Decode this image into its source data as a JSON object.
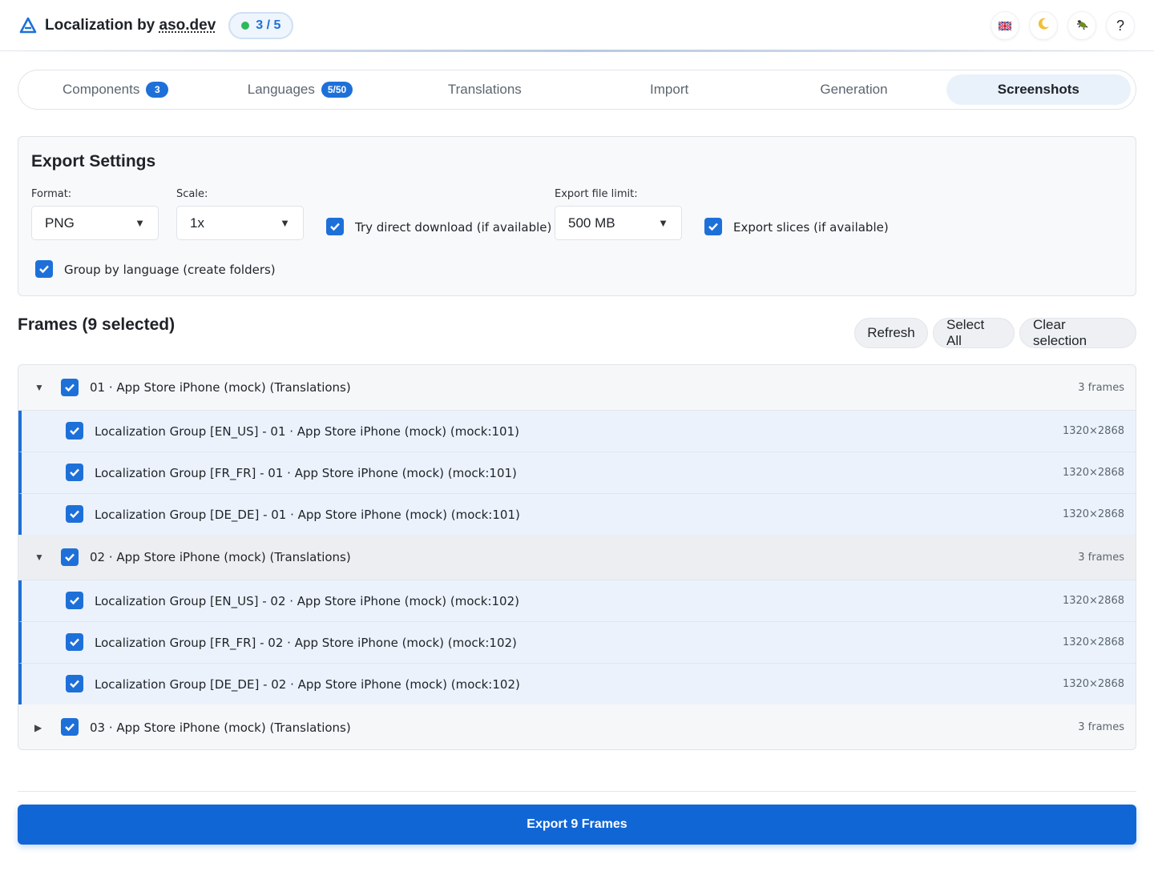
{
  "header": {
    "title_prefix": "Localization by ",
    "title_link": "aso.dev",
    "progress": "3 / 5",
    "progress_color": "#2eb85c",
    "icons": [
      "uk-flag-icon",
      "moon-icon",
      "bug-icon",
      "help-icon"
    ],
    "help_label": "?"
  },
  "tabs": [
    {
      "label": "Components",
      "badge": "3"
    },
    {
      "label": "Languages",
      "badge": "5/50"
    },
    {
      "label": "Translations"
    },
    {
      "label": "Import"
    },
    {
      "label": "Generation"
    },
    {
      "label": "Screenshots",
      "active": true
    }
  ],
  "settings": {
    "title": "Export Settings",
    "format_label": "Format:",
    "format_value": "PNG",
    "scale_label": "Scale:",
    "scale_value": "1x",
    "direct_download_label": "Try direct download (if available)",
    "direct_download_checked": true,
    "file_limit_label": "Export file limit:",
    "file_limit_value": "500 MB",
    "export_slices_label": "Export slices (if available)",
    "export_slices_checked": true,
    "group_by_language_label": "Group by language (create folders)",
    "group_by_language_checked": true
  },
  "frames": {
    "title": "Frames (9 selected)",
    "refresh_label": "Refresh",
    "select_all_label": "Select All",
    "clear_label": "Clear selection",
    "groups": [
      {
        "label": "01 · App Store iPhone (mock) (Translations)",
        "count": "3 frames",
        "expanded": true,
        "items": [
          {
            "label": "Localization Group [EN_US] - 01 · App Store iPhone (mock) (mock:101)",
            "size": "1320×2868"
          },
          {
            "label": "Localization Group [FR_FR] - 01 · App Store iPhone (mock) (mock:101)",
            "size": "1320×2868"
          },
          {
            "label": "Localization Group [DE_DE] - 01 · App Store iPhone (mock) (mock:101)",
            "size": "1320×2868"
          }
        ]
      },
      {
        "label": "02 · App Store iPhone (mock) (Translations)",
        "count": "3 frames",
        "expanded": true,
        "items": [
          {
            "label": "Localization Group [EN_US] - 02 · App Store iPhone (mock) (mock:102)",
            "size": "1320×2868"
          },
          {
            "label": "Localization Group [FR_FR] - 02 · App Store iPhone (mock) (mock:102)",
            "size": "1320×2868"
          },
          {
            "label": "Localization Group [DE_DE] - 02 · App Store iPhone (mock) (mock:102)",
            "size": "1320×2868"
          }
        ]
      },
      {
        "label": "03 · App Store iPhone (mock) (Translations)",
        "count": "3 frames",
        "expanded": false,
        "items": []
      }
    ]
  },
  "footer": {
    "export_label": "Export 9 Frames"
  },
  "colors": {
    "accent": "#1e70d9",
    "export_button": "#1166d6",
    "selected_row": "#ebf2fc"
  }
}
